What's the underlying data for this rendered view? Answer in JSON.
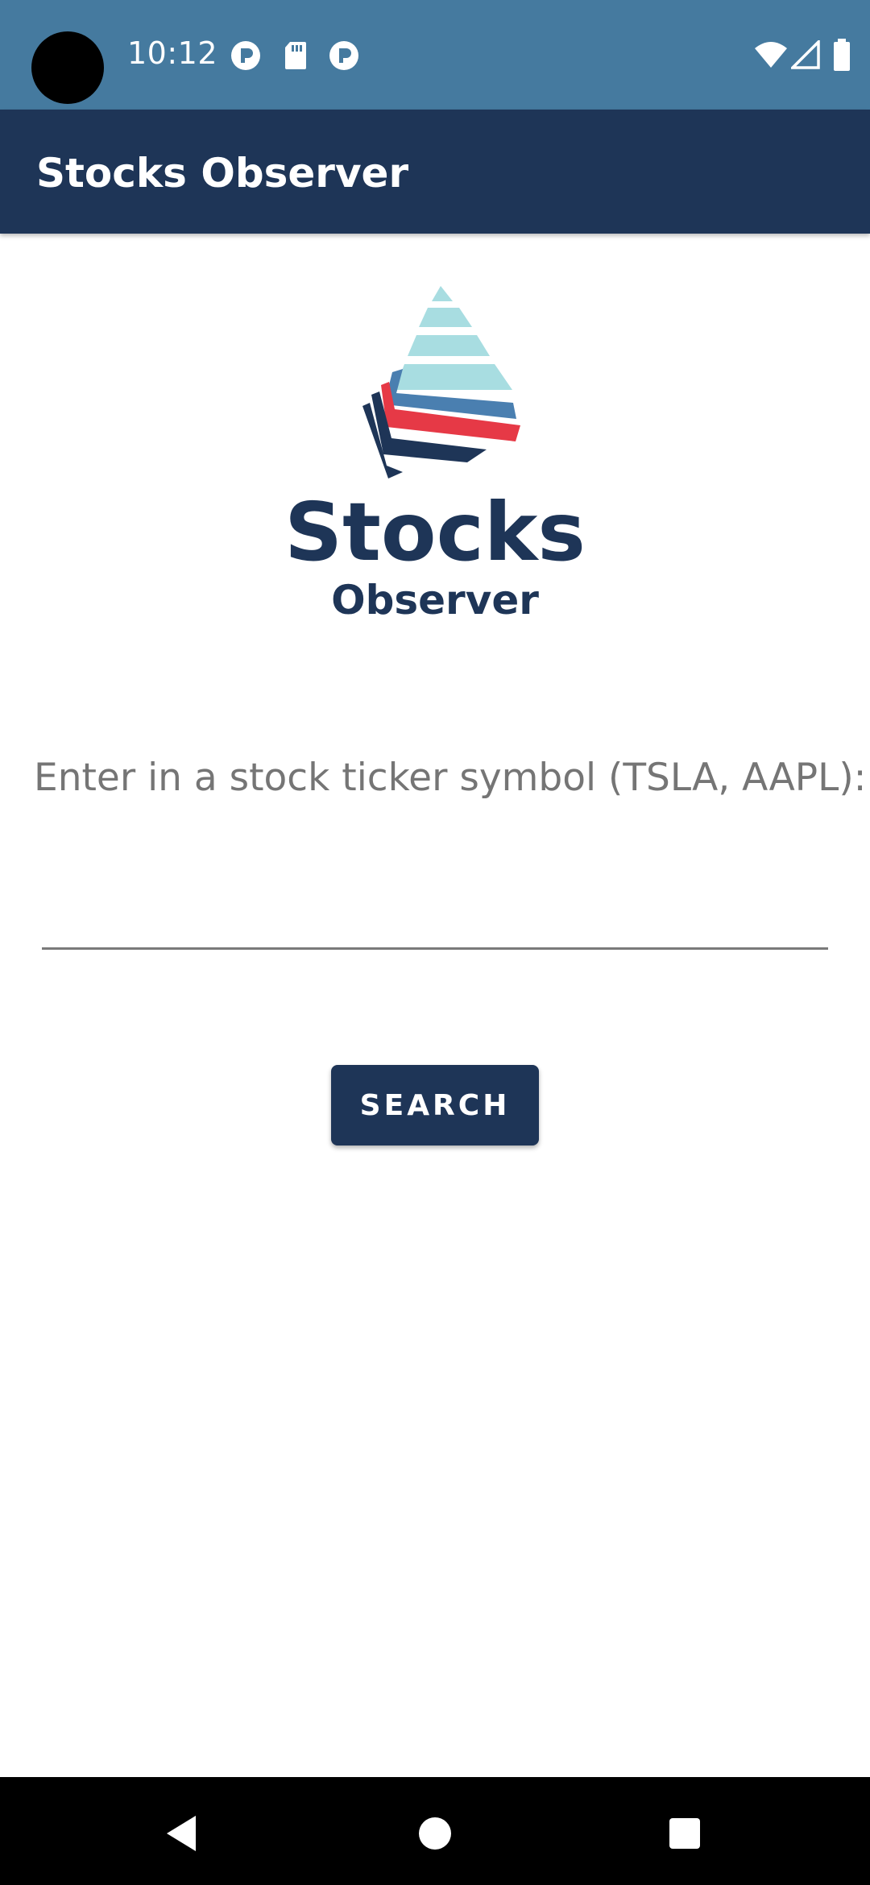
{
  "status_bar": {
    "time": "10:12",
    "icons": [
      "camera-cutout",
      "notification-p-icon",
      "sd-card-icon",
      "notification-p-icon",
      "wifi-icon",
      "cellular-signal-icon",
      "battery-icon"
    ]
  },
  "app_bar": {
    "title": "Stocks Observer"
  },
  "logo": {
    "word1": "Stocks",
    "word2": "Observer"
  },
  "form": {
    "prompt": "Enter in a stock ticker symbol (TSLA, AAPL):",
    "input_value": "",
    "input_placeholder": "",
    "search_label": "SEARCH"
  },
  "nav_bar": {
    "buttons": [
      "back-icon",
      "home-icon",
      "recents-icon"
    ]
  },
  "colors": {
    "status_bar": "#457a9f",
    "app_bar": "#1e3557",
    "button": "#1e3557",
    "logo_light": "#a8dde1",
    "logo_mid": "#4a7fb0",
    "logo_red": "#e63946",
    "logo_dark": "#1e3557"
  }
}
